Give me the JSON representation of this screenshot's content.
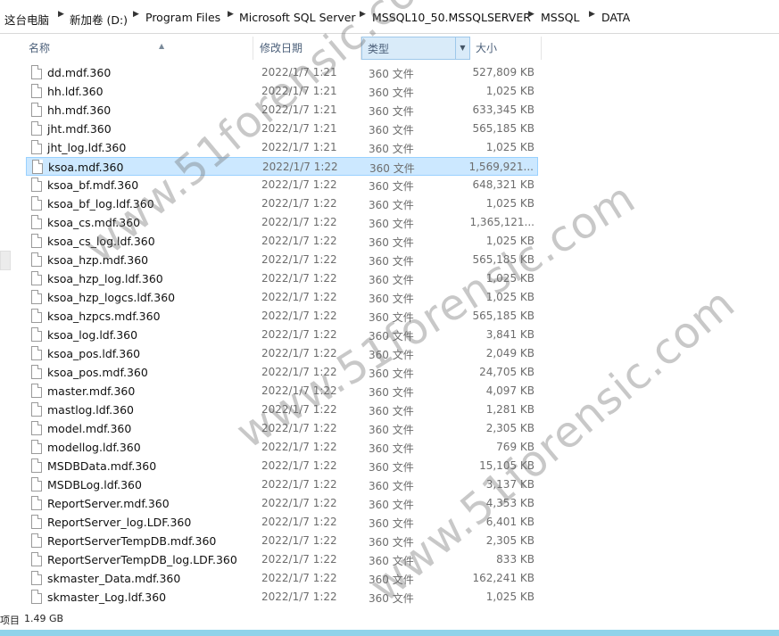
{
  "breadcrumb": [
    "这台电脑",
    "新加卷 (D:)",
    "Program Files",
    "Microsoft SQL Server",
    "MSSQL10_50.MSSQLSERVER",
    "MSSQL",
    "DATA"
  ],
  "columns": {
    "name": "名称",
    "date": "修改日期",
    "type": "类型",
    "size": "大小"
  },
  "files": [
    {
      "name": "dd.mdf.360",
      "date": "2022/1/7 1:21",
      "type": "360 文件",
      "size": "527,809 KB"
    },
    {
      "name": "hh.ldf.360",
      "date": "2022/1/7 1:21",
      "type": "360 文件",
      "size": "1,025 KB"
    },
    {
      "name": "hh.mdf.360",
      "date": "2022/1/7 1:21",
      "type": "360 文件",
      "size": "633,345 KB"
    },
    {
      "name": "jht.mdf.360",
      "date": "2022/1/7 1:21",
      "type": "360 文件",
      "size": "565,185 KB"
    },
    {
      "name": "jht_log.ldf.360",
      "date": "2022/1/7 1:21",
      "type": "360 文件",
      "size": "1,025 KB"
    },
    {
      "name": "ksoa.mdf.360",
      "date": "2022/1/7 1:22",
      "type": "360 文件",
      "size": "1,569,921..."
    },
    {
      "name": "ksoa_bf.mdf.360",
      "date": "2022/1/7 1:22",
      "type": "360 文件",
      "size": "648,321 KB"
    },
    {
      "name": "ksoa_bf_log.ldf.360",
      "date": "2022/1/7 1:22",
      "type": "360 文件",
      "size": "1,025 KB"
    },
    {
      "name": "ksoa_cs.mdf.360",
      "date": "2022/1/7 1:22",
      "type": "360 文件",
      "size": "1,365,121..."
    },
    {
      "name": "ksoa_cs_log.ldf.360",
      "date": "2022/1/7 1:22",
      "type": "360 文件",
      "size": "1,025 KB"
    },
    {
      "name": "ksoa_hzp.mdf.360",
      "date": "2022/1/7 1:22",
      "type": "360 文件",
      "size": "565,185 KB"
    },
    {
      "name": "ksoa_hzp_log.ldf.360",
      "date": "2022/1/7 1:22",
      "type": "360 文件",
      "size": "1,025 KB"
    },
    {
      "name": "ksoa_hzp_logcs.ldf.360",
      "date": "2022/1/7 1:22",
      "type": "360 文件",
      "size": "1,025 KB"
    },
    {
      "name": "ksoa_hzpcs.mdf.360",
      "date": "2022/1/7 1:22",
      "type": "360 文件",
      "size": "565,185 KB"
    },
    {
      "name": "ksoa_log.ldf.360",
      "date": "2022/1/7 1:22",
      "type": "360 文件",
      "size": "3,841 KB"
    },
    {
      "name": "ksoa_pos.ldf.360",
      "date": "2022/1/7 1:22",
      "type": "360 文件",
      "size": "2,049 KB"
    },
    {
      "name": "ksoa_pos.mdf.360",
      "date": "2022/1/7 1:22",
      "type": "360 文件",
      "size": "24,705 KB"
    },
    {
      "name": "master.mdf.360",
      "date": "2022/1/7 1:22",
      "type": "360 文件",
      "size": "4,097 KB"
    },
    {
      "name": "mastlog.ldf.360",
      "date": "2022/1/7 1:22",
      "type": "360 文件",
      "size": "1,281 KB"
    },
    {
      "name": "model.mdf.360",
      "date": "2022/1/7 1:22",
      "type": "360 文件",
      "size": "2,305 KB"
    },
    {
      "name": "modellog.ldf.360",
      "date": "2022/1/7 1:22",
      "type": "360 文件",
      "size": "769 KB"
    },
    {
      "name": "MSDBData.mdf.360",
      "date": "2022/1/7 1:22",
      "type": "360 文件",
      "size": "15,105 KB"
    },
    {
      "name": "MSDBLog.ldf.360",
      "date": "2022/1/7 1:22",
      "type": "360 文件",
      "size": "3,137 KB"
    },
    {
      "name": "ReportServer.mdf.360",
      "date": "2022/1/7 1:22",
      "type": "360 文件",
      "size": "4,353 KB"
    },
    {
      "name": "ReportServer_log.LDF.360",
      "date": "2022/1/7 1:22",
      "type": "360 文件",
      "size": "6,401 KB"
    },
    {
      "name": "ReportServerTempDB.mdf.360",
      "date": "2022/1/7 1:22",
      "type": "360 文件",
      "size": "2,305 KB"
    },
    {
      "name": "ReportServerTempDB_log.LDF.360",
      "date": "2022/1/7 1:22",
      "type": "360 文件",
      "size": "833 KB"
    },
    {
      "name": "skmaster_Data.mdf.360",
      "date": "2022/1/7 1:22",
      "type": "360 文件",
      "size": "162,241 KB"
    },
    {
      "name": "skmaster_Log.ldf.360",
      "date": "2022/1/7 1:22",
      "type": "360 文件",
      "size": "1,025 KB"
    }
  ],
  "selected_index": 5,
  "status": {
    "items_label": "项目",
    "selected_size": "1.49 GB"
  },
  "watermark": "www.51forensic.com",
  "colors": {
    "selection": "#cce8ff",
    "selection_border": "#99d1ff",
    "header_sorted": "#d9ebf9",
    "taskbar": "#8fd3ea"
  }
}
